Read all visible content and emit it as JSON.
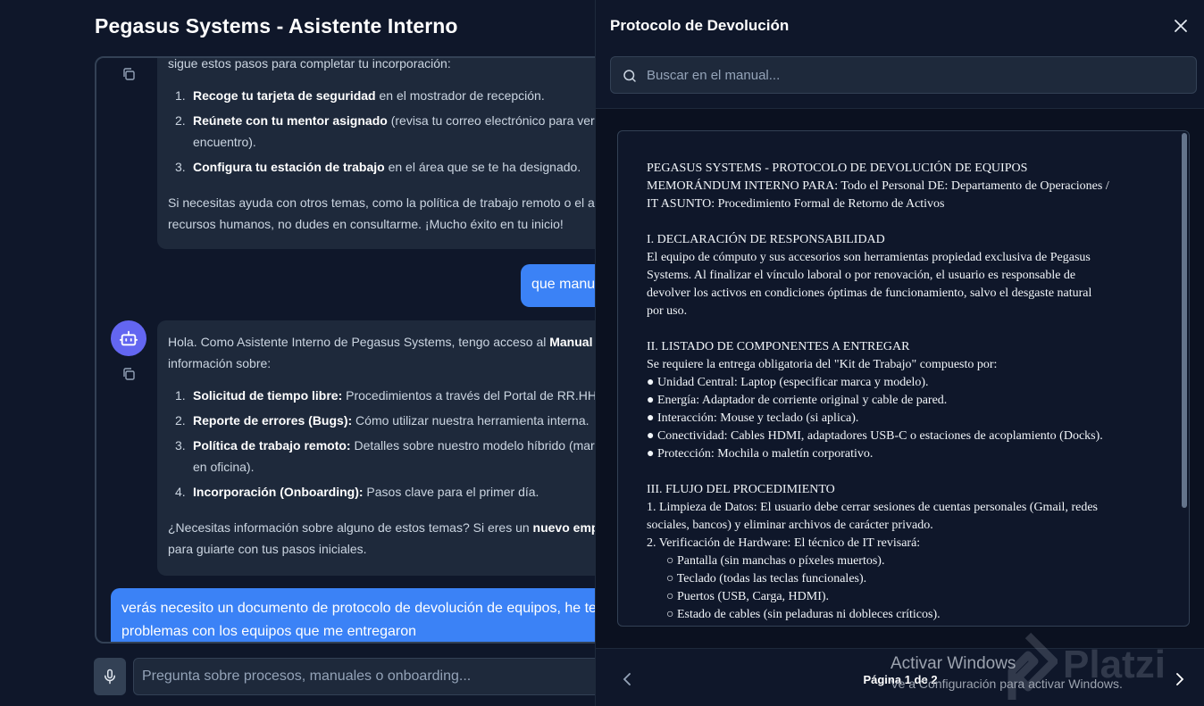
{
  "app": {
    "title": "Pegasus Systems - Asistente Interno"
  },
  "messages": {
    "bot1": {
      "intro": "sigue estos pasos para completar tu incorporación:",
      "steps": [
        {
          "num": "1.",
          "bold": "Recoge tu tarjeta de seguridad",
          "rest": " en el mostrador de recepción."
        },
        {
          "num": "2.",
          "bold": "Reúnete con tu mentor asignado",
          "rest": " (revisa tu correo electrónico para ver q",
          "rest2": "encuentro)."
        },
        {
          "num": "3.",
          "bold": "Configura tu estación de trabajo",
          "rest": " en el área que se te ha designado."
        }
      ],
      "outro1": "Si necesitas ayuda con otros temas, como la política de trabajo remoto o el ac",
      "outro2": "recursos humanos, no dudes en consultarme. ¡Mucho éxito en tu inicio!"
    },
    "user1": {
      "text": "que manu"
    },
    "bot2": {
      "intro_pre": "Hola. Como Asistente Interno de Pegasus Systems, tengo acceso al ",
      "intro_bold": "Manual In",
      "intro2": "información sobre:",
      "items": [
        {
          "num": "1.",
          "bold": "Solicitud de tiempo libre:",
          "rest": " Procedimientos a través del Portal de RR.HH."
        },
        {
          "num": "2.",
          "bold": "Reporte de errores (Bugs):",
          "rest": " Cómo utilizar nuestra herramienta interna."
        },
        {
          "num": "3.",
          "bold": "Política de trabajo remoto:",
          "rest": " Detalles sobre nuestro modelo híbrido (marte",
          "rest2": "en oficina)."
        },
        {
          "num": "4.",
          "bold": "Incorporación (Onboarding):",
          "rest": " Pasos clave para el primer día."
        }
      ],
      "outro_pre": "¿Necesitas información sobre alguno de estos temas? Si eres un ",
      "outro_bold": "nuevo emple",
      "outro2": "para guiarte con tus pasos iniciales."
    },
    "user2": {
      "line1": "verás necesito un documento de protocolo de devolución de equipos, he te",
      "line2": "problemas con los equipos que me entregaron"
    }
  },
  "input": {
    "placeholder": "Pregunta sobre procesos, manuales o onboarding..."
  },
  "panel": {
    "title": "Protocolo de Devolución",
    "search_placeholder": "Buscar en el manual...",
    "document_lines": [
      {
        "text": "PEGASUS SYSTEMS - PROTOCOLO DE DEVOLUCIÓN DE EQUIPOS"
      },
      {
        "text": "MEMORÁNDUM INTERNO PARA: Todo el Personal DE: Departamento de Operaciones /"
      },
      {
        "text": "IT ASUNTO: Procedimiento Formal de Retorno de Activos"
      },
      {
        "text": ""
      },
      {
        "text": "I. DECLARACIÓN DE RESPONSABILIDAD"
      },
      {
        "text": "El equipo de cómputo y sus accesorios son herramientas propiedad exclusiva de Pegasus"
      },
      {
        "text": "Systems. Al finalizar el vínculo laboral o por renovación, el usuario es responsable de"
      },
      {
        "text": "devolver los activos en condiciones óptimas de funcionamiento, salvo el desgaste natural"
      },
      {
        "text": "por uso."
      },
      {
        "text": ""
      },
      {
        "text": "II. LISTADO DE COMPONENTES A ENTREGAR"
      },
      {
        "text": "Se requiere la entrega obligatoria del \"Kit de Trabajo\" compuesto por:"
      },
      {
        "text": "● Unidad Central: Laptop (especificar marca y modelo)."
      },
      {
        "text": "● Energía: Adaptador de corriente original y cable de pared."
      },
      {
        "text": "● Interacción: Mouse y teclado (si aplica)."
      },
      {
        "text": "● Conectividad: Cables HDMI, adaptadores USB-C o estaciones de acoplamiento (Docks)."
      },
      {
        "text": "● Protección: Mochila o maletín corporativo."
      },
      {
        "text": ""
      },
      {
        "text": "III. FLUJO DEL PROCEDIMIENTO"
      },
      {
        "text": "1. Limpieza de Datos: El usuario debe cerrar sesiones de cuentas personales (Gmail, redes"
      },
      {
        "text": "sociales, bancos) y eliminar archivos de carácter privado."
      },
      {
        "text": "2. Verificación de Hardware: El técnico de IT revisará:"
      },
      {
        "text": "○ Pantalla (sin manchas o píxeles muertos).",
        "sub": true
      },
      {
        "text": "○ Teclado (todas las teclas funcionales).",
        "sub": true
      },
      {
        "text": "○ Puertos (USB, Carga, HDMI).",
        "sub": true
      },
      {
        "text": "○ Estado de cables (sin peladuras ni dobleces críticos).",
        "sub": true
      }
    ],
    "page_indicator": "Página 1 de 2"
  },
  "watermarks": {
    "windows_line1": "Activar Windows",
    "windows_line2": "Ve a Configuración para activar Windows.",
    "platzi": "Platzi"
  }
}
